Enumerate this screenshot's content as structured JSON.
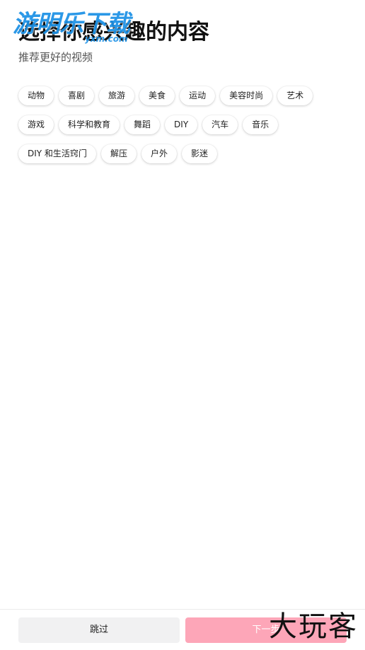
{
  "watermark": {
    "main": "游明乐下载",
    "sub": "yxm.com",
    "corner": "大玩客"
  },
  "header": {
    "title": "选择你感兴趣的内容",
    "subtitle": "推荐更好的视频"
  },
  "tags": [
    "动物",
    "喜剧",
    "旅游",
    "美食",
    "运动",
    "美容时尚",
    "艺术",
    "游戏",
    "科学和教育",
    "舞蹈",
    "DIY",
    "汽车",
    "音乐",
    "DIY 和生活窍门",
    "解压",
    "户外",
    "影迷"
  ],
  "footer": {
    "skip_label": "跳过",
    "next_label": "下一步"
  },
  "colors": {
    "next_button": "#fda6b8",
    "skip_button": "#f1f1f2",
    "watermark_blue": "#1a90e6"
  }
}
